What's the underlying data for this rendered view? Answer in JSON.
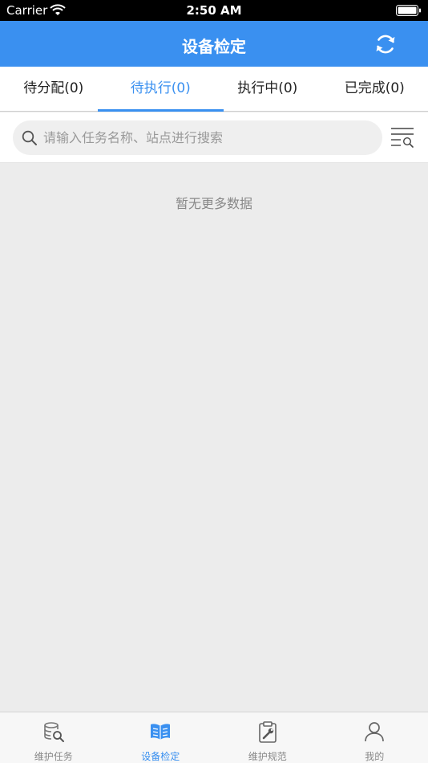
{
  "status_bar": {
    "carrier": "Carrier",
    "time": "2:50 AM"
  },
  "nav": {
    "title": "设备检定",
    "refresh_icon": "refresh-icon"
  },
  "tabs": [
    {
      "label": "待分配(0)",
      "active": false
    },
    {
      "label": "待执行(0)",
      "active": true
    },
    {
      "label": "执行中(0)",
      "active": false
    },
    {
      "label": "已完成(0)",
      "active": false
    }
  ],
  "search": {
    "placeholder": "请输入任务名称、站点进行搜索",
    "value": ""
  },
  "filter": {
    "icon": "filter-list-icon"
  },
  "empty_message": "暂无更多数据",
  "tab_bar": {
    "items": [
      {
        "label": "维护任务",
        "icon": "database-search-icon",
        "active": false
      },
      {
        "label": "设备检定",
        "icon": "open-book-icon",
        "active": true
      },
      {
        "label": "维护规范",
        "icon": "clipboard-wrench-icon",
        "active": false
      },
      {
        "label": "我的",
        "icon": "user-icon",
        "active": false
      }
    ]
  },
  "colors": {
    "primary": "#3a90f0",
    "background": "#ececec",
    "inactive_text": "#888888"
  }
}
